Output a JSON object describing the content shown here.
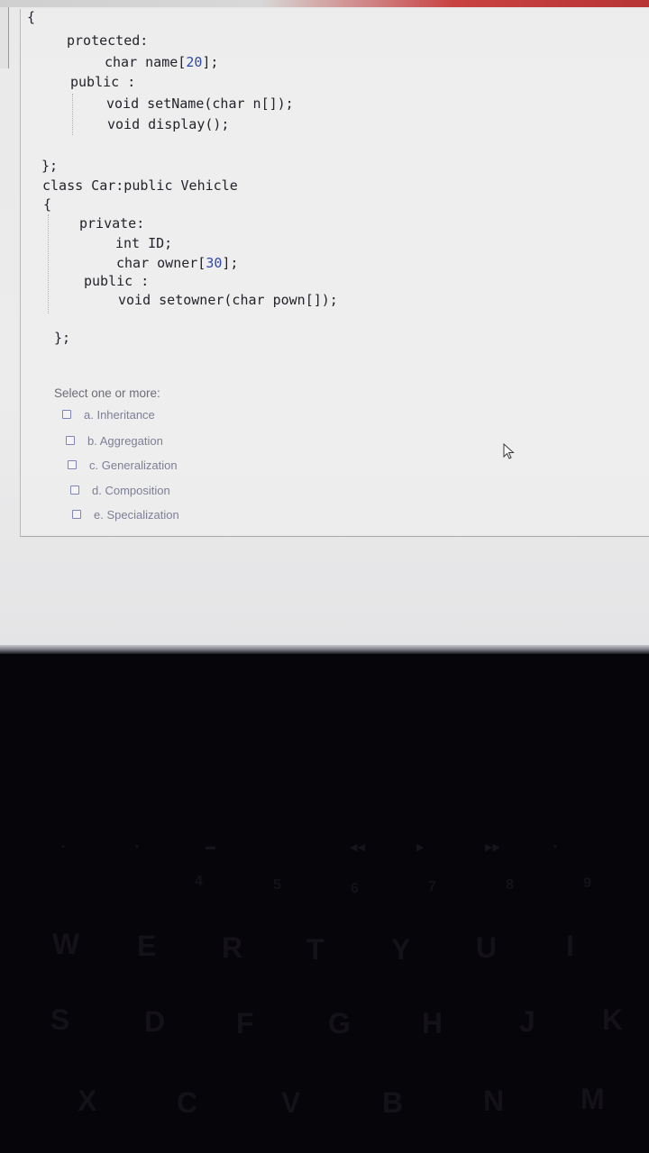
{
  "code_lines": [
    "{",
    "protected:",
    "char name[20];",
    "public :",
    "void setName(char n[]);",
    "void display();",
    "};",
    "class Car:public Vehicle",
    "{",
    "private:",
    "int ID;",
    "char owner[30];",
    "public :",
    "void setowner(char pown[]);",
    "};"
  ],
  "question": {
    "prompt": "Select one or more:",
    "options": [
      {
        "label": "a. Inheritance",
        "checked": false
      },
      {
        "label": "b. Aggregation",
        "checked": false
      },
      {
        "label": "c. Generalization",
        "checked": false
      },
      {
        "label": "d. Composition",
        "checked": false
      },
      {
        "label": "e. Specialization",
        "checked": false
      }
    ]
  },
  "keyboard": {
    "number_row": [
      "4",
      "5",
      "6",
      "7",
      "8",
      "9"
    ],
    "top_row": [
      "W",
      "E",
      "R",
      "T",
      "Y",
      "U",
      "I"
    ],
    "home_row": [
      "S",
      "D",
      "F",
      "G",
      "H",
      "J",
      "K"
    ],
    "bottom_row": [
      "X",
      "C",
      "V",
      "B",
      "N",
      "M"
    ]
  },
  "colors": {
    "code_text": "#23232b",
    "code_number": "#2f4aa8",
    "option_text": "#7d7f95",
    "keyboard_bg": "#060509"
  }
}
